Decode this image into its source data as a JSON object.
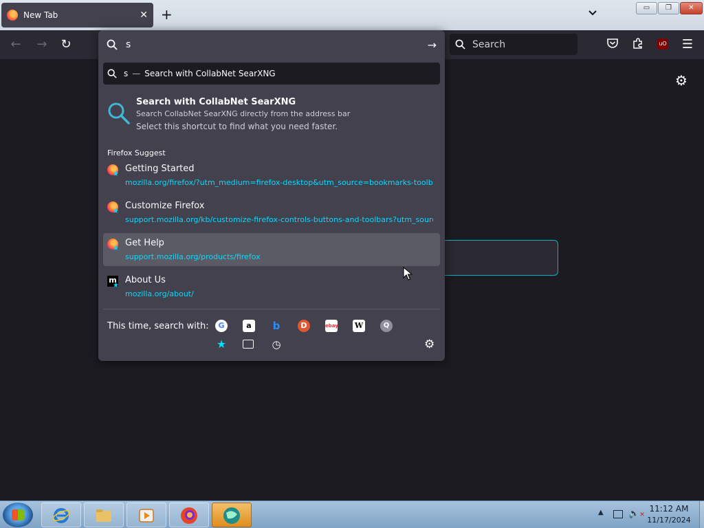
{
  "tab": {
    "title": "New Tab",
    "close": "✕"
  },
  "toolbar": {
    "new_tab": "+",
    "list_all_tabs": "⌄",
    "back": "←",
    "forward": "→",
    "reload": "↻",
    "search_placeholder": "Search",
    "menu": "☰"
  },
  "window_controls": {
    "minimize": "▭",
    "maximize": "❐",
    "close": "✕"
  },
  "urlbar": {
    "query": "s",
    "go": "→",
    "heuristic": {
      "query": "s",
      "separator": "—",
      "action": "Search with CollabNet SearXNG"
    },
    "tip": {
      "title": "Search with CollabNet SearXNG",
      "subtitle": "Search CollabNet SearXNG directly from the address bar",
      "description": "Select this shortcut to find what you need faster."
    },
    "group_label": "Firefox Suggest",
    "results": [
      {
        "title": "Getting Started",
        "url": "mozilla.org/firefox/?utm_medium=firefox-desktop&utm_source=bookmarks-toolbar"
      },
      {
        "title": "Customize Firefox",
        "url": "support.mozilla.org/kb/customize-firefox-controls-buttons-and-toolbars?utm_source=firefox-browser"
      },
      {
        "title": "Get Help",
        "url": "support.mozilla.org/products/firefox"
      },
      {
        "title": "About Us",
        "url": "mozilla.org/about/"
      }
    ],
    "one_off_label": "This time, search with:",
    "engines": [
      "G",
      "a",
      "b",
      "D",
      "ebay",
      "W",
      "Q"
    ]
  },
  "icons": {
    "search": "search-icon",
    "gear": "gear-icon",
    "pocket": "pocket-icon",
    "extensions": "extensions-icon",
    "ublock": "uBlock-icon",
    "bookmark_star": "★",
    "history": "◷",
    "page_settings": "⚙"
  },
  "ublock_label": "uO",
  "taskbar": {
    "time": "11:12 AM",
    "date": "11/17/2024",
    "tray_up": "▲"
  },
  "colors": {
    "accent": "#00ddff",
    "panel": "#42414d",
    "toolbar": "#2b2a33",
    "page": "#1c1b22"
  }
}
